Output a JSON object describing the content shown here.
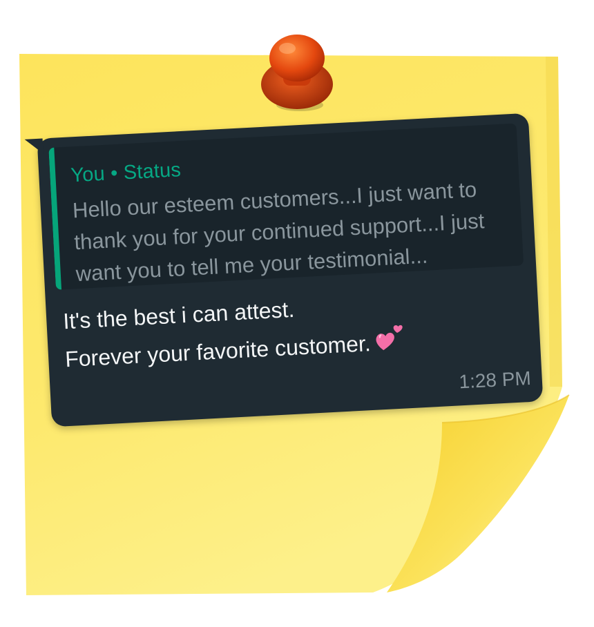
{
  "note": {
    "paper_color": "#fde86a",
    "pin_color": "#e24a14"
  },
  "bubble": {
    "background": "#1f2b33",
    "quote": {
      "author_label": "You • Status",
      "accent_color": "#06a57a",
      "text": "Hello our esteem customers...I just want to thank you for your continued support...I just want you to tell me your testimonial..."
    },
    "message": {
      "line1": "It's the best i can attest.",
      "line2": "Forever your favorite customer.",
      "emoji_icon": "two-hearts-icon"
    },
    "timestamp": "1:28 PM"
  }
}
